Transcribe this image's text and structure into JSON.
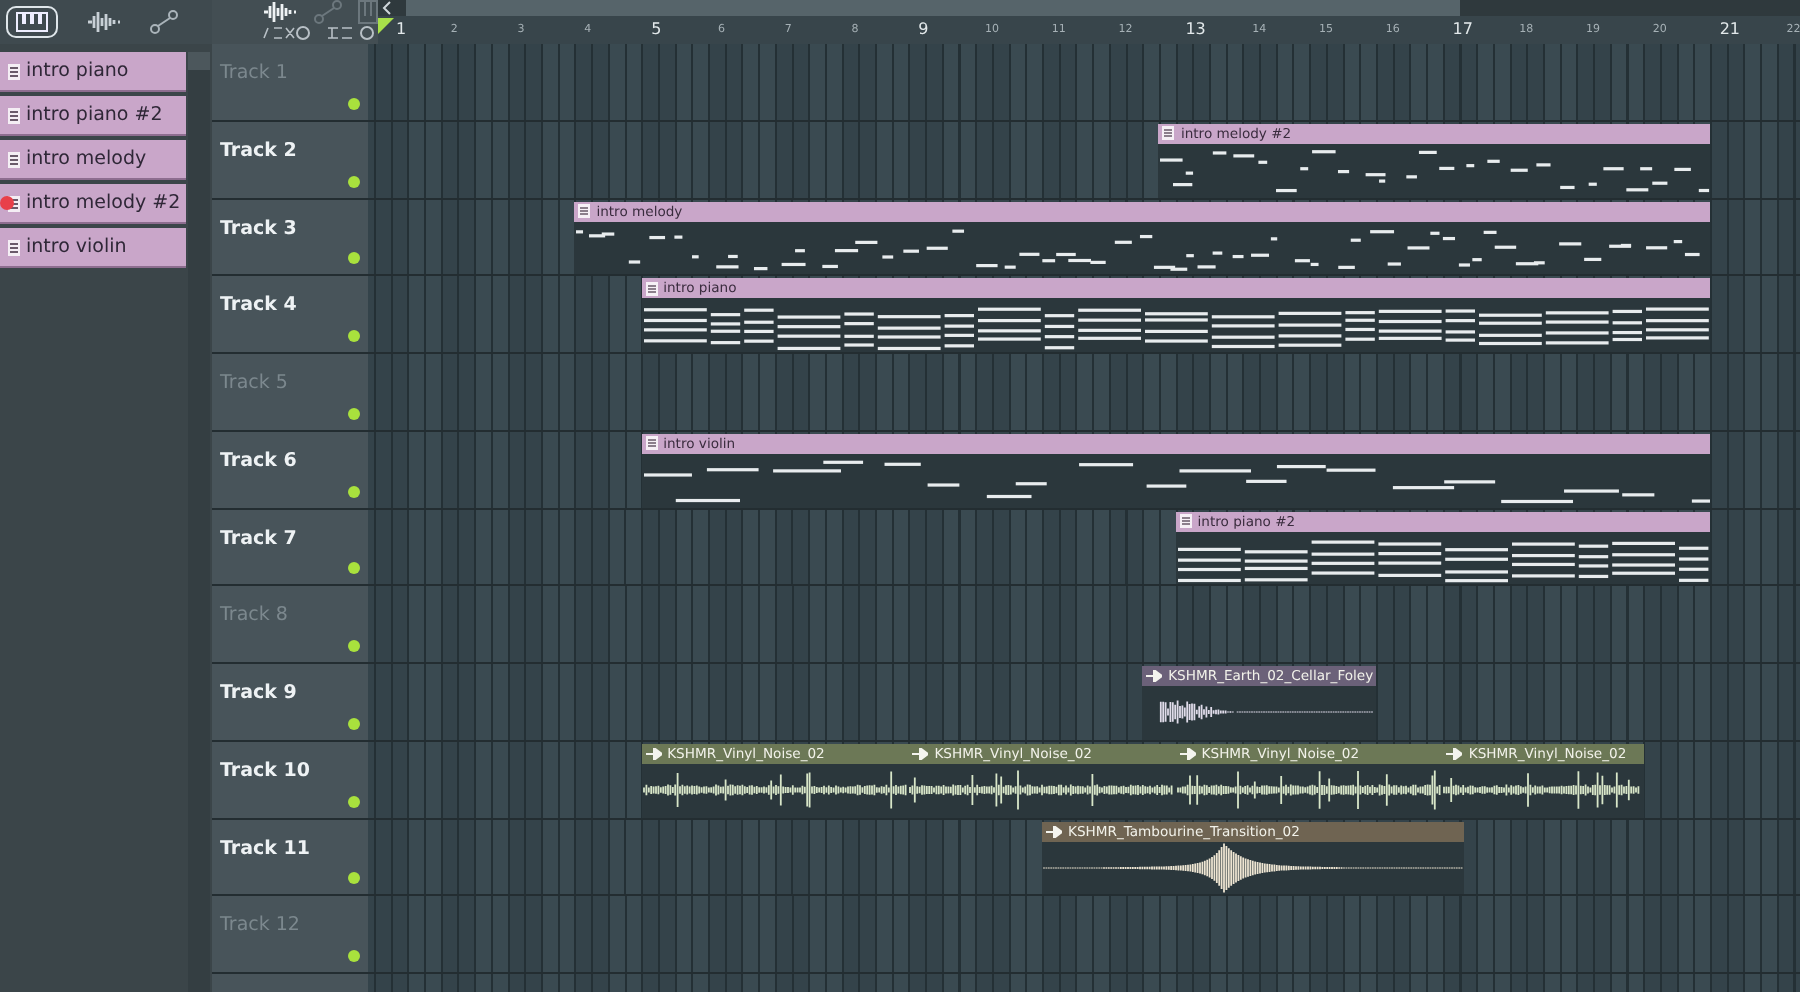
{
  "patterns": [
    {
      "name": "intro piano",
      "selected": false
    },
    {
      "name": "intro piano #2",
      "selected": false
    },
    {
      "name": "intro melody",
      "selected": false
    },
    {
      "name": "intro melody #2",
      "selected": true
    },
    {
      "name": "intro violin",
      "selected": false
    }
  ],
  "ruler": [
    {
      "label": "1",
      "major": true
    },
    {
      "label": "2",
      "major": false
    },
    {
      "label": "3",
      "major": false
    },
    {
      "label": "4",
      "major": false
    },
    {
      "label": "5",
      "major": true
    },
    {
      "label": "6",
      "major": false
    },
    {
      "label": "7",
      "major": false
    },
    {
      "label": "8",
      "major": false
    },
    {
      "label": "9",
      "major": true
    },
    {
      "label": "10",
      "major": false
    },
    {
      "label": "11",
      "major": false
    },
    {
      "label": "12",
      "major": false
    },
    {
      "label": "13",
      "major": true
    },
    {
      "label": "14",
      "major": false
    },
    {
      "label": "15",
      "major": false
    },
    {
      "label": "16",
      "major": false
    },
    {
      "label": "17",
      "major": true
    },
    {
      "label": "18",
      "major": false
    },
    {
      "label": "19",
      "major": false
    },
    {
      "label": "20",
      "major": false
    },
    {
      "label": "21",
      "major": true
    },
    {
      "label": "22",
      "major": false
    }
  ],
  "tracks": [
    {
      "name": "Track 1",
      "dimmed": true
    },
    {
      "name": "Track 2",
      "dimmed": false,
      "clips": [
        {
          "name": "intro melody #2",
          "kind": "pattern",
          "color": "#c9a6c9"
        }
      ]
    },
    {
      "name": "Track 3",
      "dimmed": false,
      "clips": [
        {
          "name": "intro melody",
          "kind": "pattern",
          "color": "#c9a6c9"
        }
      ]
    },
    {
      "name": "Track 4",
      "dimmed": false,
      "clips": [
        {
          "name": "intro piano",
          "kind": "pattern",
          "color": "#c9a6c9"
        }
      ]
    },
    {
      "name": "Track 5",
      "dimmed": true
    },
    {
      "name": "Track 6",
      "dimmed": false,
      "clips": [
        {
          "name": "intro violin",
          "kind": "pattern",
          "color": "#c9a6c9"
        }
      ]
    },
    {
      "name": "Track 7",
      "dimmed": false,
      "clips": [
        {
          "name": "intro piano #2",
          "kind": "pattern",
          "color": "#c9a6c9"
        }
      ]
    },
    {
      "name": "Track 8",
      "dimmed": true
    },
    {
      "name": "Track 9",
      "dimmed": false,
      "clips": [
        {
          "name": "KSHMR_Earth_02_Cellar_Foley",
          "kind": "audio",
          "color": "#6b6179"
        }
      ]
    },
    {
      "name": "Track 10",
      "dimmed": false,
      "clips": [
        {
          "name": "KSHMR_Vinyl_Noise_02",
          "kind": "audio",
          "color": "#6c7856"
        },
        {
          "name": "KSHMR_Vinyl_Noise_02",
          "kind": "audio",
          "color": "#6c7856"
        },
        {
          "name": "KSHMR_Vinyl_Noise_02",
          "kind": "audio",
          "color": "#6c7856"
        },
        {
          "name": "KSHMR_Vinyl_Noise_02",
          "kind": "audio",
          "color": "#6c7856"
        }
      ]
    },
    {
      "name": "Track 11",
      "dimmed": false,
      "clips": [
        {
          "name": "KSHMR_Tambourine_Transition_02",
          "kind": "audio",
          "color": "#6f6452"
        }
      ]
    },
    {
      "name": "Track 12",
      "dimmed": true
    }
  ]
}
